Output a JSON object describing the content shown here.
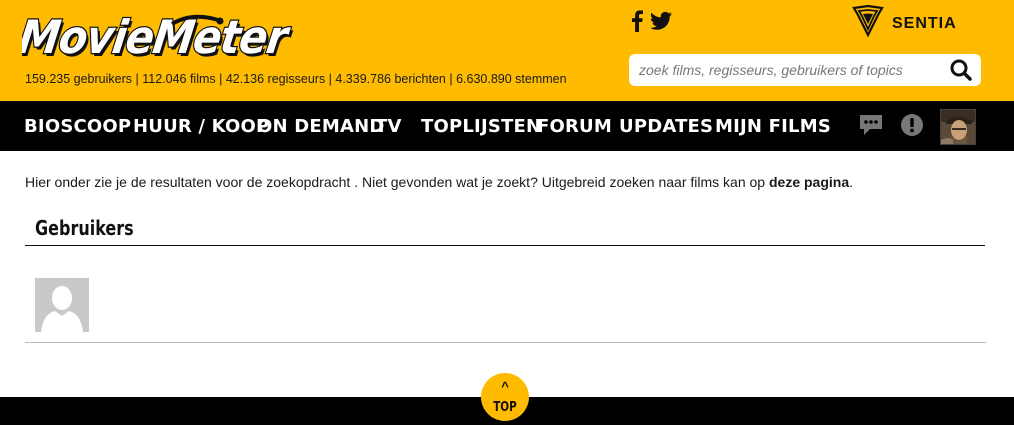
{
  "brand": {
    "logo_text": "MovieMeter",
    "sponsor_name": "SENTIA"
  },
  "header": {
    "stats": "159.235 gebruikers | 112.046 films | 42.136 regisseurs | 4.339.786 berichten | 6.630.890 stemmen",
    "social": [
      {
        "icon": "facebook-icon"
      },
      {
        "icon": "twitter-icon"
      }
    ],
    "search": {
      "placeholder": "zoek films, regisseurs, gebruikers of topics",
      "value": "",
      "icon": "search-icon"
    }
  },
  "nav": {
    "items": [
      {
        "label": "BIOSCOOP"
      },
      {
        "label": "HUUR / KOOP"
      },
      {
        "label": "ON DEMAND"
      },
      {
        "label": "TV"
      },
      {
        "label": "TOPLIJSTEN"
      },
      {
        "label": "FORUM"
      },
      {
        "label": "UPDATES"
      },
      {
        "label": "MIJN FILMS"
      }
    ],
    "icons": [
      "messages-icon",
      "alert-icon",
      "user-avatar"
    ]
  },
  "main": {
    "intro_text": "Hier onder zie je de resultaten voor de zoekopdracht . Niet gevonden wat je zoekt? Uitgebreid zoeken naar films kan op ",
    "intro_link": "deze pagina",
    "intro_end": ".",
    "section_title": "Gebruikers",
    "results": [
      {
        "avatar": "default-user-avatar"
      }
    ]
  },
  "footer": {
    "top_caret": "^",
    "top_label": "TOP"
  },
  "colors": {
    "accent": "#ffbb00",
    "nav_background": "#000000",
    "text": "#1a1a1a"
  }
}
